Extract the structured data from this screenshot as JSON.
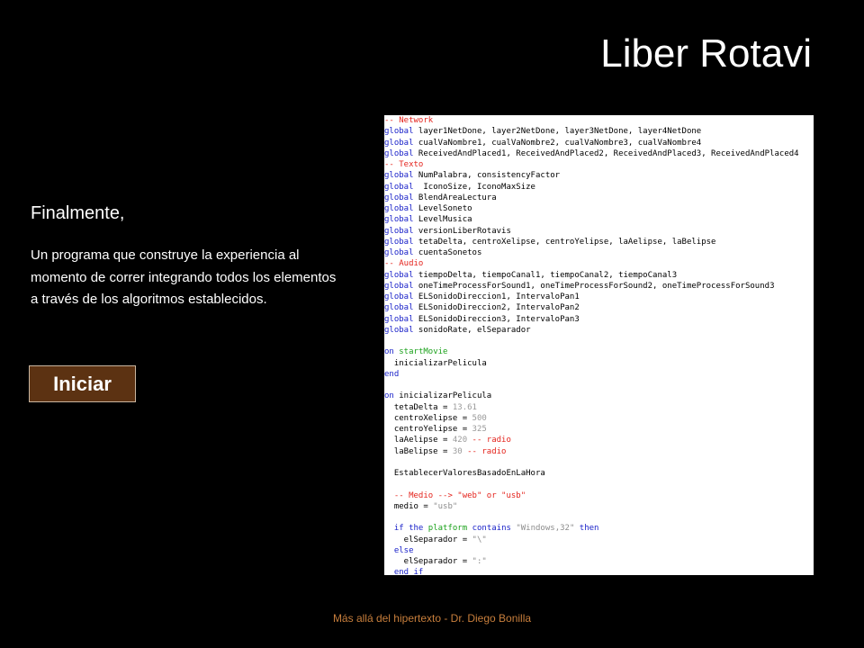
{
  "slide": {
    "title": "Liber Rotavi",
    "heading": "Finalmente,",
    "body": "Un programa que construye la experiencia al momento de correr integrando todos los elementos a través de los algoritmos establecidos.",
    "start_button_label": "Iniciar",
    "footer": "Más allá del hipertexto - Dr. Diego Bonilla"
  },
  "colors": {
    "background": "#000000",
    "button_fill": "#5c3212",
    "footer_text": "#c77e3c",
    "code_comment": "#e4231c",
    "code_keyword": "#1a22c9",
    "code_handler": "#1aa11a",
    "code_literal": "#9a9a9a"
  },
  "code": [
    [
      [
        "comment",
        "-- Network"
      ]
    ],
    [
      [
        "keyword",
        "global"
      ],
      [
        "plain",
        " layer1NetDone, layer2NetDone, layer3NetDone, layer4NetDone"
      ]
    ],
    [
      [
        "keyword",
        "global"
      ],
      [
        "plain",
        " cualVaNombre1, cualVaNombre2, cualVaNombre3, cualVaNombre4"
      ]
    ],
    [
      [
        "keyword",
        "global"
      ],
      [
        "plain",
        " ReceivedAndPlaced1, ReceivedAndPlaced2, ReceivedAndPlaced3, ReceivedAndPlaced4"
      ]
    ],
    [
      [
        "comment",
        "-- Texto"
      ]
    ],
    [
      [
        "keyword",
        "global"
      ],
      [
        "plain",
        " NumPalabra, consistencyFactor"
      ]
    ],
    [
      [
        "keyword",
        "global"
      ],
      [
        "plain",
        "  IconoSize, IconoMaxSize"
      ]
    ],
    [
      [
        "keyword",
        "global"
      ],
      [
        "plain",
        " BlendAreaLectura"
      ]
    ],
    [
      [
        "keyword",
        "global"
      ],
      [
        "plain",
        " LevelSoneto"
      ]
    ],
    [
      [
        "keyword",
        "global"
      ],
      [
        "plain",
        " LevelMusica"
      ]
    ],
    [
      [
        "keyword",
        "global"
      ],
      [
        "plain",
        " versionLiberRotavis"
      ]
    ],
    [
      [
        "keyword",
        "global"
      ],
      [
        "plain",
        " tetaDelta, centroXelipse, centroYelipse, laAelipse, laBelipse"
      ]
    ],
    [
      [
        "keyword",
        "global"
      ],
      [
        "plain",
        " cuentaSonetos"
      ]
    ],
    [
      [
        "comment",
        "-- Audio"
      ]
    ],
    [
      [
        "keyword",
        "global"
      ],
      [
        "plain",
        " tiempoDelta, tiempoCanal1, tiempoCanal2, tiempoCanal3"
      ]
    ],
    [
      [
        "keyword",
        "global"
      ],
      [
        "plain",
        " oneTimeProcessForSound1, oneTimeProcessForSound2, oneTimeProcessForSound3"
      ]
    ],
    [
      [
        "keyword",
        "global"
      ],
      [
        "plain",
        " ELSonidoDireccion1, IntervaloPan1"
      ]
    ],
    [
      [
        "keyword",
        "global"
      ],
      [
        "plain",
        " ELSonidoDireccion2, IntervaloPan2"
      ]
    ],
    [
      [
        "keyword",
        "global"
      ],
      [
        "plain",
        " ELSonidoDireccion3, IntervaloPan3"
      ]
    ],
    [
      [
        "keyword",
        "global"
      ],
      [
        "plain",
        " sonidoRate, elSeparador"
      ]
    ],
    [],
    [
      [
        "keyword",
        "on"
      ],
      [
        "plain",
        " "
      ],
      [
        "handler",
        "startMovie"
      ]
    ],
    [
      [
        "plain",
        "  inicializarPelicula"
      ]
    ],
    [
      [
        "keyword",
        "end"
      ]
    ],
    [],
    [
      [
        "keyword",
        "on"
      ],
      [
        "plain",
        " inicializarPelicula"
      ]
    ],
    [
      [
        "plain",
        "  tetaDelta = "
      ],
      [
        "number",
        "13.61"
      ]
    ],
    [
      [
        "plain",
        "  centroXelipse = "
      ],
      [
        "number",
        "500"
      ]
    ],
    [
      [
        "plain",
        "  centroYelipse = "
      ],
      [
        "number",
        "325"
      ]
    ],
    [
      [
        "plain",
        "  laAelipse = "
      ],
      [
        "number",
        "420"
      ],
      [
        "plain",
        " "
      ],
      [
        "comment",
        "-- radio"
      ]
    ],
    [
      [
        "plain",
        "  laBelipse = "
      ],
      [
        "number",
        "30"
      ],
      [
        "plain",
        " "
      ],
      [
        "comment",
        "-- radio"
      ]
    ],
    [],
    [
      [
        "plain",
        "  EstablecerValoresBasadoEnLaHora"
      ]
    ],
    [],
    [
      [
        "comment",
        "  -- Medio --> \"web\" or \"usb\""
      ]
    ],
    [
      [
        "plain",
        "  medio = "
      ],
      [
        "string",
        "\"usb\""
      ]
    ],
    [],
    [
      [
        "keyword",
        "  if the"
      ],
      [
        "plain",
        " "
      ],
      [
        "handler",
        "platform"
      ],
      [
        "plain",
        " "
      ],
      [
        "keyword",
        "contains"
      ],
      [
        "plain",
        " "
      ],
      [
        "string",
        "\"Windows,32\""
      ],
      [
        "plain",
        " "
      ],
      [
        "keyword",
        "then"
      ]
    ],
    [
      [
        "plain",
        "    elSeparador = "
      ],
      [
        "string",
        "\"\\\""
      ]
    ],
    [
      [
        "keyword",
        "  else"
      ]
    ],
    [
      [
        "plain",
        "    elSeparador = "
      ],
      [
        "string",
        "\":\""
      ]
    ],
    [
      [
        "keyword",
        "  end if"
      ]
    ]
  ]
}
